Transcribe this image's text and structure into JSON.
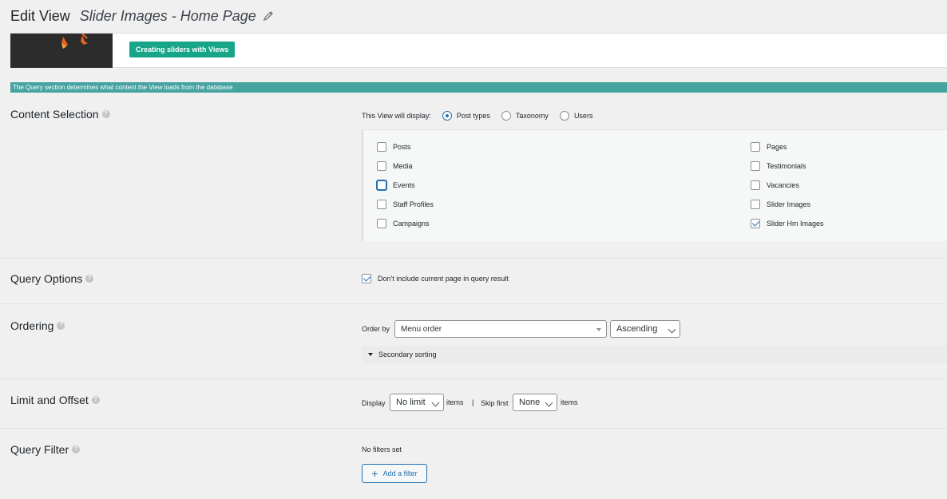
{
  "header": {
    "title": "Edit View",
    "view_name": "Slider Images - Home Page"
  },
  "banner": {
    "button_label": "Creating sliders with Views"
  },
  "query_bar": {
    "text": "The Query section determines what content the View loads from the database"
  },
  "content_selection": {
    "label": "Content Selection",
    "display_label": "This View will display:",
    "radios": [
      {
        "label": "Post types",
        "checked": true
      },
      {
        "label": "Taxonomy",
        "checked": false
      },
      {
        "label": "Users",
        "checked": false
      }
    ],
    "types_left": [
      {
        "label": "Posts",
        "checked": false
      },
      {
        "label": "Media",
        "checked": false
      },
      {
        "label": "Events",
        "checked": false
      },
      {
        "label": "Staff Profiles",
        "checked": false
      },
      {
        "label": "Campaigns",
        "checked": false
      }
    ],
    "types_right": [
      {
        "label": "Pages",
        "checked": false
      },
      {
        "label": "Testimonials",
        "checked": false
      },
      {
        "label": "Vacancies",
        "checked": false
      },
      {
        "label": "Slider Images",
        "checked": false
      },
      {
        "label": "Slider Hm Images",
        "checked": true
      }
    ]
  },
  "query_options": {
    "label": "Query Options",
    "exclude_current_label": "Don't include current page in query result",
    "exclude_current_checked": true
  },
  "ordering": {
    "label": "Ordering",
    "order_by_label": "Order by",
    "order_by_value": "Menu order",
    "direction_value": "Ascending",
    "secondary_label": "Secondary sorting"
  },
  "limit_offset": {
    "label": "Limit and Offset",
    "display_label": "Display",
    "limit_value": "No limit",
    "items_label": "items",
    "separator": "|",
    "skip_label": "Skip first",
    "skip_value": "None",
    "items_label_2": "items"
  },
  "query_filter": {
    "label": "Query Filter",
    "status": "No filters set",
    "add_button": "Add a filter"
  },
  "colors": {
    "accent": "#2271b1",
    "teal_bar": "#45a4a0",
    "green_button": "#17a589"
  }
}
